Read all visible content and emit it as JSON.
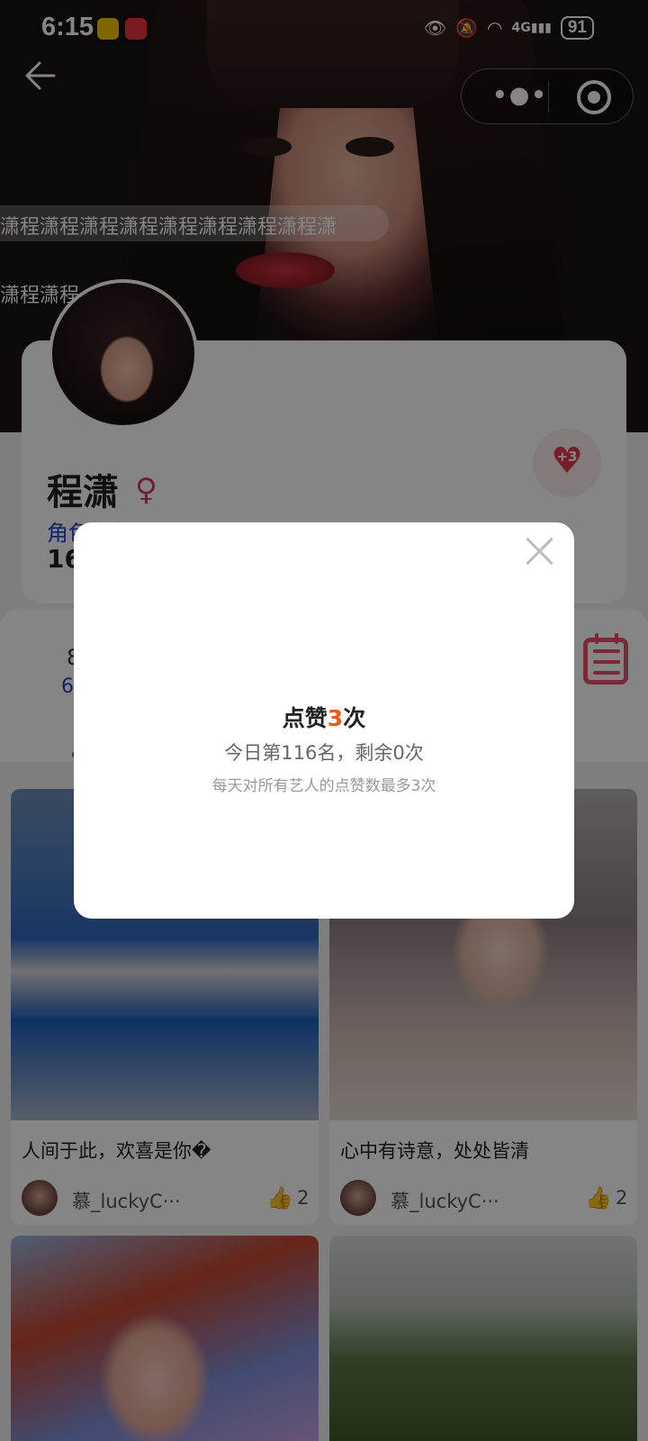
{
  "status_bar": {
    "time": "6:15",
    "battery": "91",
    "network": "4G"
  },
  "danmaku": {
    "line1": "潇程潇程潇程潇程潇程潇程潇程潇程潇",
    "line2": "潇程潇程"
  },
  "profile": {
    "name": "程潇",
    "gender_symbol": "♀",
    "role_label": "角色指数",
    "role_value": "16",
    "like_button_badge": "+3"
  },
  "stats": {
    "value_a": "8",
    "value_b": "6"
  },
  "feed": [
    {
      "title": "人间于此，欢喜是你�",
      "user": "慕_luckyC···",
      "likes": "2"
    },
    {
      "title": "心中有诗意，处处皆清",
      "user": "慕_luckyC···",
      "likes": "2"
    }
  ],
  "modal": {
    "title_prefix": "点赞",
    "title_count": "3",
    "title_suffix": "次",
    "rank_text": "今日第116名，剩余0次",
    "note": "每天对所有艺人的点赞数最多3次"
  },
  "colors": {
    "accent": "#ef5a1c",
    "heart": "#e83a4c",
    "link_blue": "#2742d0",
    "female": "#e0336a"
  },
  "icons": [
    "back-arrow-icon",
    "more-icon",
    "target-icon",
    "female-icon",
    "heart-icon",
    "calendar-icon",
    "thumbs-up-icon",
    "close-icon",
    "eye-icon",
    "mute-icon",
    "wifi-icon",
    "signal-icon"
  ]
}
